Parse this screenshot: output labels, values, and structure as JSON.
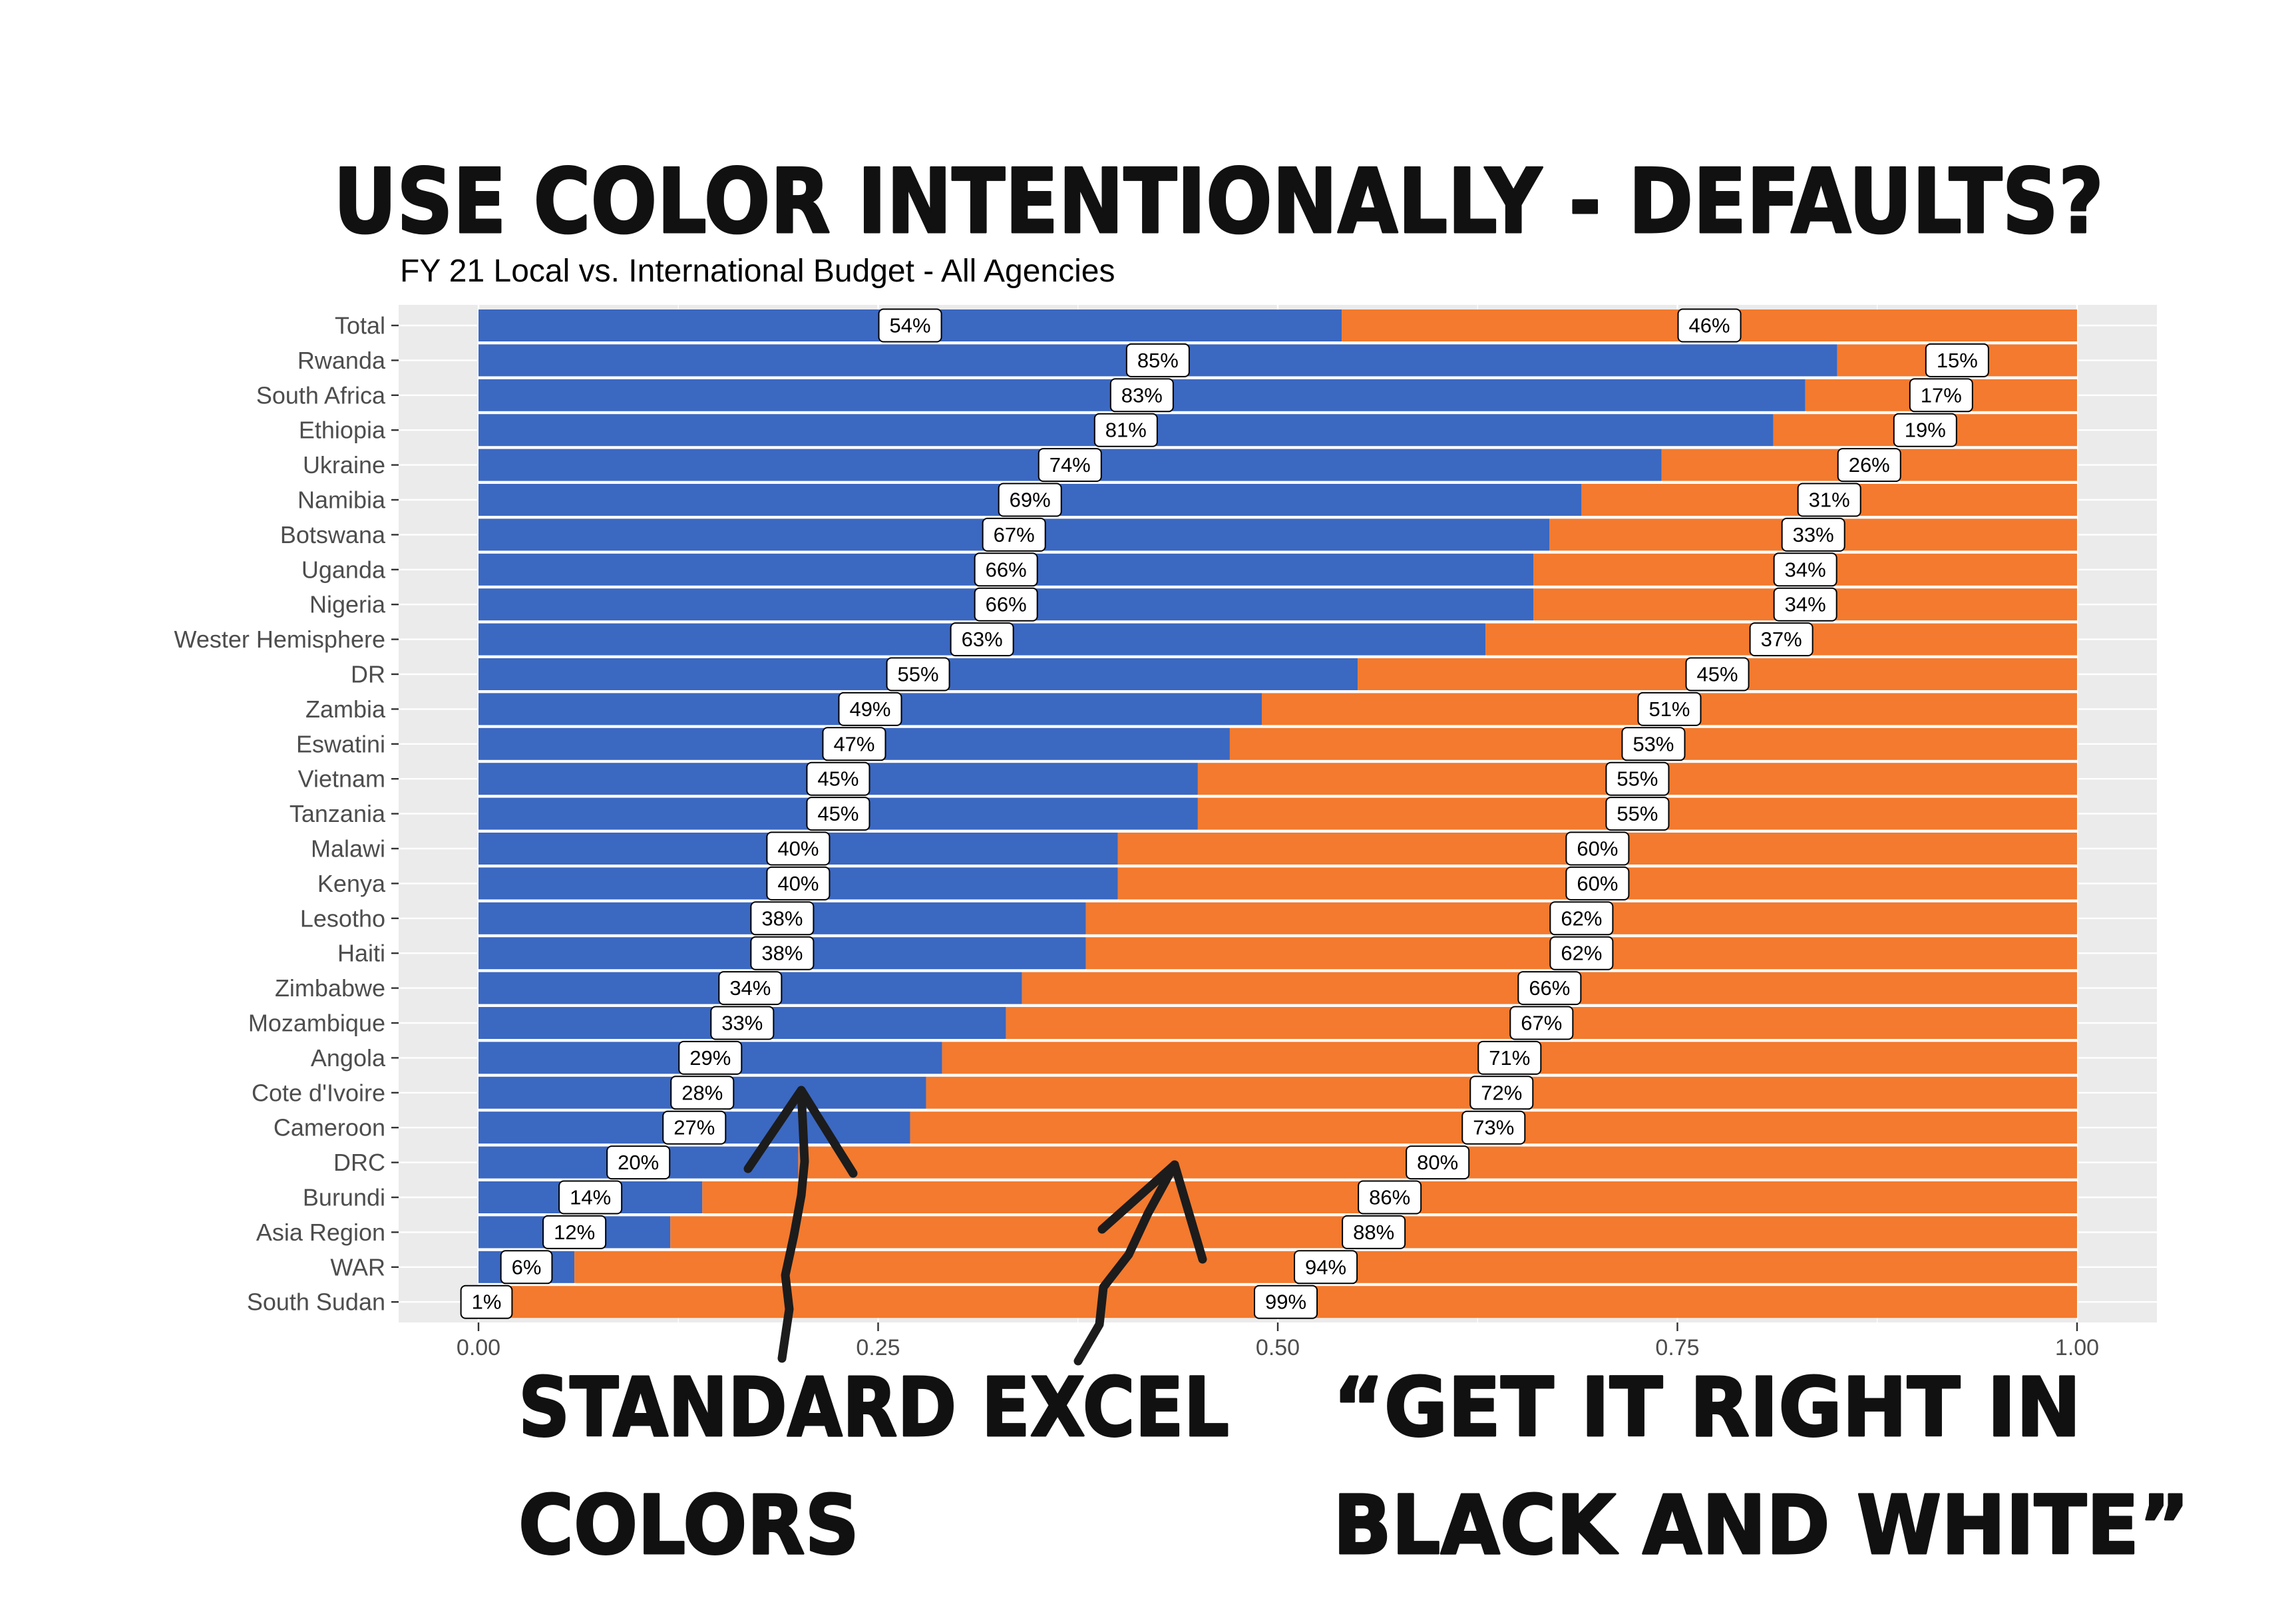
{
  "heading": "USE COLOR INTENTIONALLY - DEFAULTS?",
  "annotations": {
    "left": {
      "lines": [
        "STANDARD EXCEL",
        "COLORS"
      ]
    },
    "right": {
      "lines": [
        "“GET IT RIGHT IN",
        "BLACK AND WHITE”"
      ]
    }
  },
  "colors": {
    "panel": "#EBEBEB",
    "gridline": "#FFFFFF",
    "axis_text": "#4D4D4D",
    "axis_tick": "#333333"
  },
  "chart_data": {
    "type": "bar",
    "orientation": "horizontal",
    "stacked": true,
    "title": "FY 21 Local vs. International Budget - All Agencies",
    "xlabel": "",
    "ylabel": "",
    "xlim": [
      0,
      1
    ],
    "xticks": [
      0,
      0.25,
      0.5,
      0.75,
      1
    ],
    "xtick_labels": [
      "0.00",
      "0.25",
      "0.50",
      "0.75",
      "1.00"
    ],
    "grid": true,
    "legend": "none",
    "categories": [
      "Total",
      "Rwanda",
      "South Africa",
      "Ethiopia",
      "Ukraine",
      "Namibia",
      "Botswana",
      "Uganda",
      "Nigeria",
      "Wester Hemisphere",
      "DR",
      "Zambia",
      "Eswatini",
      "Vietnam",
      "Tanzania",
      "Malawi",
      "Kenya",
      "Lesotho",
      "Haiti",
      "Zimbabwe",
      "Mozambique",
      "Angola",
      "Cote d'Ivoire",
      "Cameroon",
      "DRC",
      "Burundi",
      "Asia Region",
      "WAR",
      "South Sudan"
    ],
    "series": [
      {
        "color": "#3B68C1",
        "values": [
          0.54,
          0.85,
          0.83,
          0.81,
          0.74,
          0.69,
          0.67,
          0.66,
          0.66,
          0.63,
          0.55,
          0.49,
          0.47,
          0.45,
          0.45,
          0.4,
          0.4,
          0.38,
          0.38,
          0.34,
          0.33,
          0.29,
          0.28,
          0.27,
          0.2,
          0.14,
          0.12,
          0.06,
          0.01
        ],
        "labels": [
          "54%",
          "85%",
          "83%",
          "81%",
          "74%",
          "69%",
          "67%",
          "66%",
          "66%",
          "63%",
          "55%",
          "49%",
          "47%",
          "45%",
          "45%",
          "40%",
          "40%",
          "38%",
          "38%",
          "34%",
          "33%",
          "29%",
          "28%",
          "27%",
          "20%",
          "14%",
          "12%",
          "6%",
          "1%"
        ]
      },
      {
        "color": "#F37A2E",
        "values": [
          0.46,
          0.15,
          0.17,
          0.19,
          0.26,
          0.31,
          0.33,
          0.34,
          0.34,
          0.37,
          0.45,
          0.51,
          0.53,
          0.55,
          0.55,
          0.6,
          0.6,
          0.62,
          0.62,
          0.66,
          0.67,
          0.71,
          0.72,
          0.73,
          0.8,
          0.86,
          0.88,
          0.94,
          0.99
        ],
        "labels": [
          "46%",
          "15%",
          "17%",
          "19%",
          "26%",
          "31%",
          "33%",
          "34%",
          "34%",
          "37%",
          "45%",
          "51%",
          "53%",
          "55%",
          "55%",
          "60%",
          "60%",
          "62%",
          "62%",
          "66%",
          "67%",
          "71%",
          "72%",
          "73%",
          "80%",
          "86%",
          "88%",
          "94%",
          "99%"
        ]
      }
    ]
  }
}
